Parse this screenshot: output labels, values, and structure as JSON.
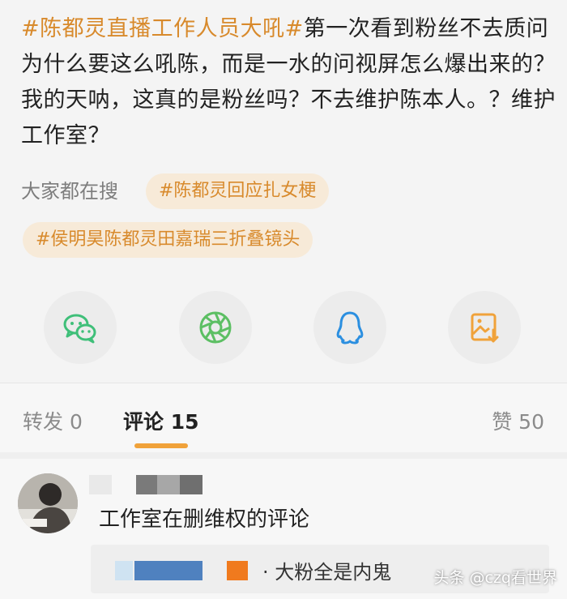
{
  "post": {
    "topic": "#陈都灵直播工作人员大吼#",
    "body": "第一次看到粉丝不去质问为什么要这么吼陈，而是一水的问视屏怎么爆出来的？我的天呐，这真的是粉丝吗？不去维护陈本人。？维护工作室？"
  },
  "search": {
    "label": "大家都在搜",
    "chips": [
      "#陈都灵回应扎女梗",
      "#侯明昊陈都灵田嘉瑞三折叠镜头"
    ]
  },
  "share": {
    "icons": [
      "wechat-icon",
      "moments-icon",
      "qq-icon",
      "save-image-icon"
    ]
  },
  "tabs": {
    "repost": "转发 0",
    "comment": "评论 15",
    "like": "赞 50"
  },
  "comment": {
    "text": "工作室在删维权的评论",
    "reply": "· 大粉全是内鬼"
  },
  "watermark": "头条 @czq看世界",
  "colors": {
    "accent": "#d88a2c",
    "underline": "#f0a23a",
    "wechat": "#3fbf79",
    "moments": "#5cbf63",
    "qq": "#2b8fe0",
    "save": "#f0a23a"
  }
}
